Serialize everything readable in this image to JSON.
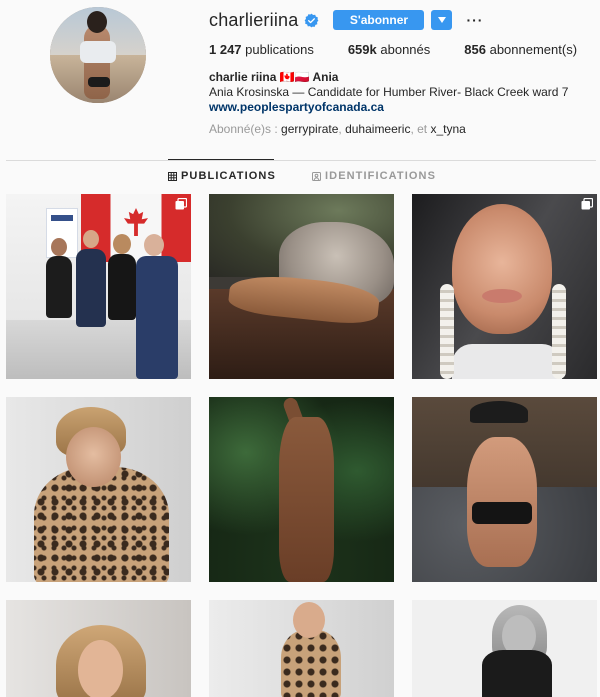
{
  "profile": {
    "username": "charlieriina",
    "follow_label": "S'abonner",
    "more_label": "···",
    "stats": {
      "posts_count": "1 247",
      "posts_label": "publications",
      "followers_count": "659k",
      "followers_label": "abonnés",
      "following_count": "856",
      "following_label": "abonnement(s)"
    },
    "fullname": "charlie riina 🇨🇦🇵🇱 Ania",
    "bio_text": "Ania Krosinska — Candidate for Humber River- Black Creek ward 7",
    "bio_link": "www.peoplespartyofcanada.ca",
    "followed_by_prefix": "Abonné(e)s : ",
    "followed_by_users": [
      "gerrypirate",
      "duhaimeeric",
      "x_tyna"
    ],
    "followed_by_sep1": ", ",
    "followed_by_sep2": ", et "
  },
  "tabs": {
    "publications": "PUBLICATIONS",
    "identifications": "IDENTIFICATIONS"
  },
  "colors": {
    "accent": "#3897f0",
    "link": "#003569",
    "muted": "#999999",
    "text": "#262626",
    "background": "#fafafa"
  },
  "icons": {
    "verified": "verified-badge-icon",
    "dropdown": "chevron-down-icon",
    "more": "more-options-icon",
    "grid": "grid-icon",
    "tagged": "tagged-icon",
    "multi": "multiple-photos-icon"
  },
  "posts": [
    {
      "index": 1,
      "multi": true
    },
    {
      "index": 2,
      "multi": false
    },
    {
      "index": 3,
      "multi": true
    },
    {
      "index": 4,
      "multi": false
    },
    {
      "index": 5,
      "multi": false
    },
    {
      "index": 6,
      "multi": false
    },
    {
      "index": 7,
      "multi": false
    },
    {
      "index": 8,
      "multi": false
    },
    {
      "index": 9,
      "multi": false
    }
  ]
}
